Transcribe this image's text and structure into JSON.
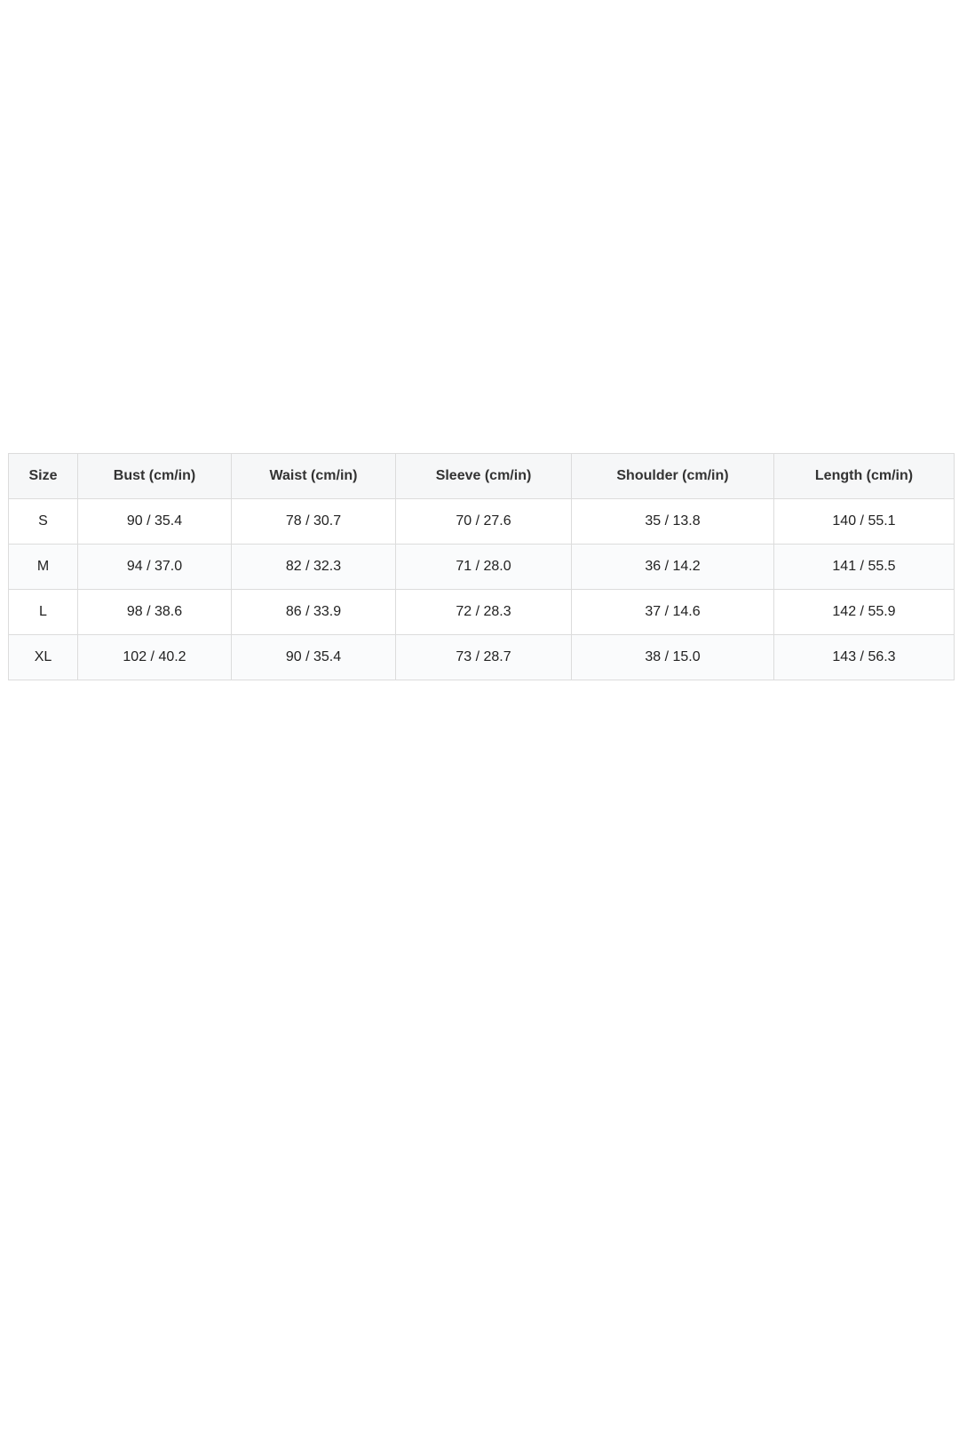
{
  "size_table": {
    "headers": [
      "Size",
      "Bust (cm/in)",
      "Waist (cm/in)",
      "Sleeve (cm/in)",
      "Shoulder (cm/in)",
      "Length (cm/in)"
    ],
    "rows": [
      [
        "S",
        "90 / 35.4",
        "78 / 30.7",
        "70 / 27.6",
        "35 / 13.8",
        "140 / 55.1"
      ],
      [
        "M",
        "94 / 37.0",
        "82 / 32.3",
        "71 / 28.0",
        "36 / 14.2",
        "141 / 55.5"
      ],
      [
        "L",
        "98 / 38.6",
        "86 / 33.9",
        "72 / 28.3",
        "37 / 14.6",
        "142 / 55.9"
      ],
      [
        "XL",
        "102 / 40.2",
        "90 / 35.4",
        "73 / 28.7",
        "38 / 15.0",
        "143 / 56.3"
      ]
    ]
  }
}
